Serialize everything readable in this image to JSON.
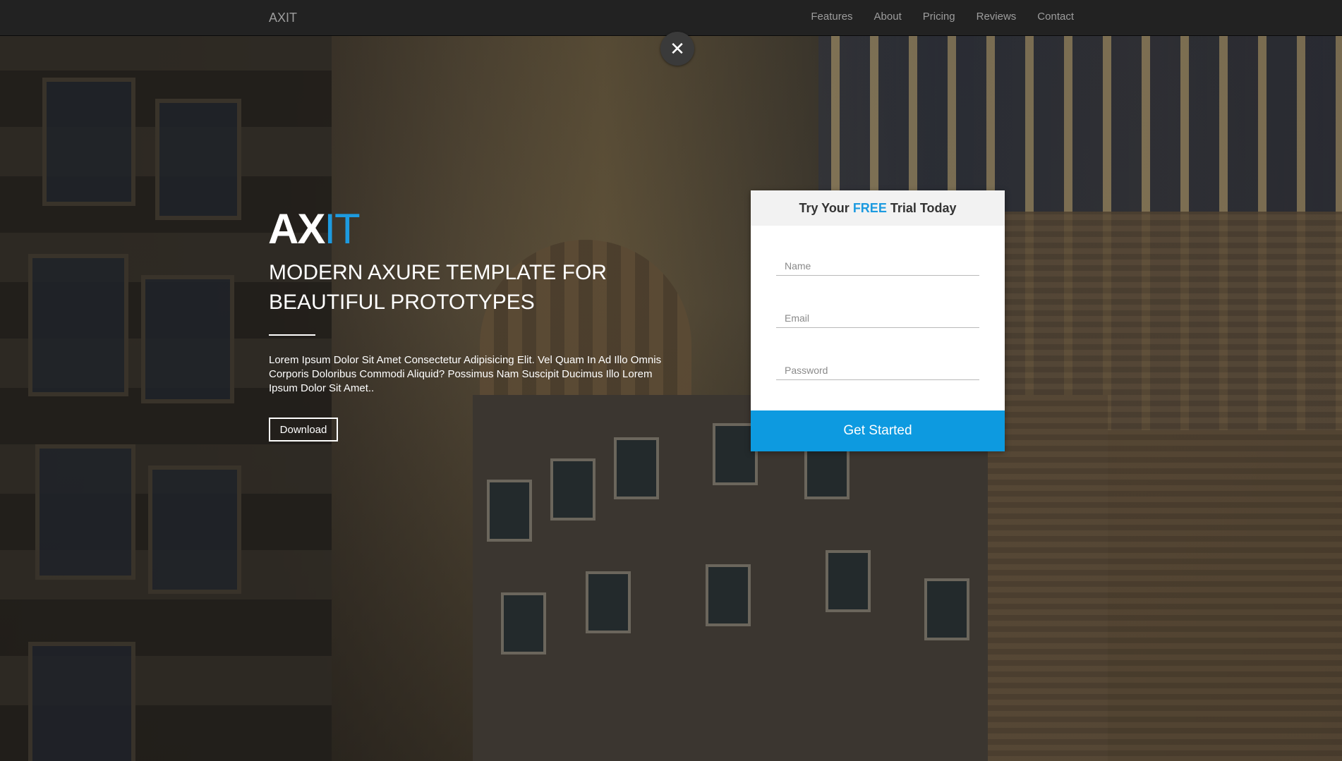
{
  "navbar": {
    "brand": "AXIT",
    "links": [
      "Features",
      "About",
      "Pricing",
      "Reviews",
      "Contact"
    ]
  },
  "close_button": {
    "icon": "close-icon",
    "glyph": "✕"
  },
  "hero": {
    "logo_main": "AX",
    "logo_accent": "IT",
    "headline": "MODERN AXURE TEMPLATE FOR BEAUTIFUL PROTOTYPES",
    "lead": "Lorem Ipsum Dolor Sit Amet Consectetur Adipisicing Elit. Vel Quam In Ad Illo Omnis Corporis Doloribus Commodi Aliquid? Possimus Nam Suscipit Ducimus Illo Lorem Ipsum Dolor Sit Amet..",
    "download_label": "Download"
  },
  "signup": {
    "title_prefix": "Try Your",
    "title_highlight": "FREE",
    "title_suffix": "Trial Today",
    "name_placeholder": "Name",
    "email_placeholder": "Email",
    "password_placeholder": "Password",
    "submit_label": "Get Started"
  },
  "colors": {
    "accent": "#1d9be0",
    "navbar": "#222222",
    "submit": "#0d9ae0"
  }
}
